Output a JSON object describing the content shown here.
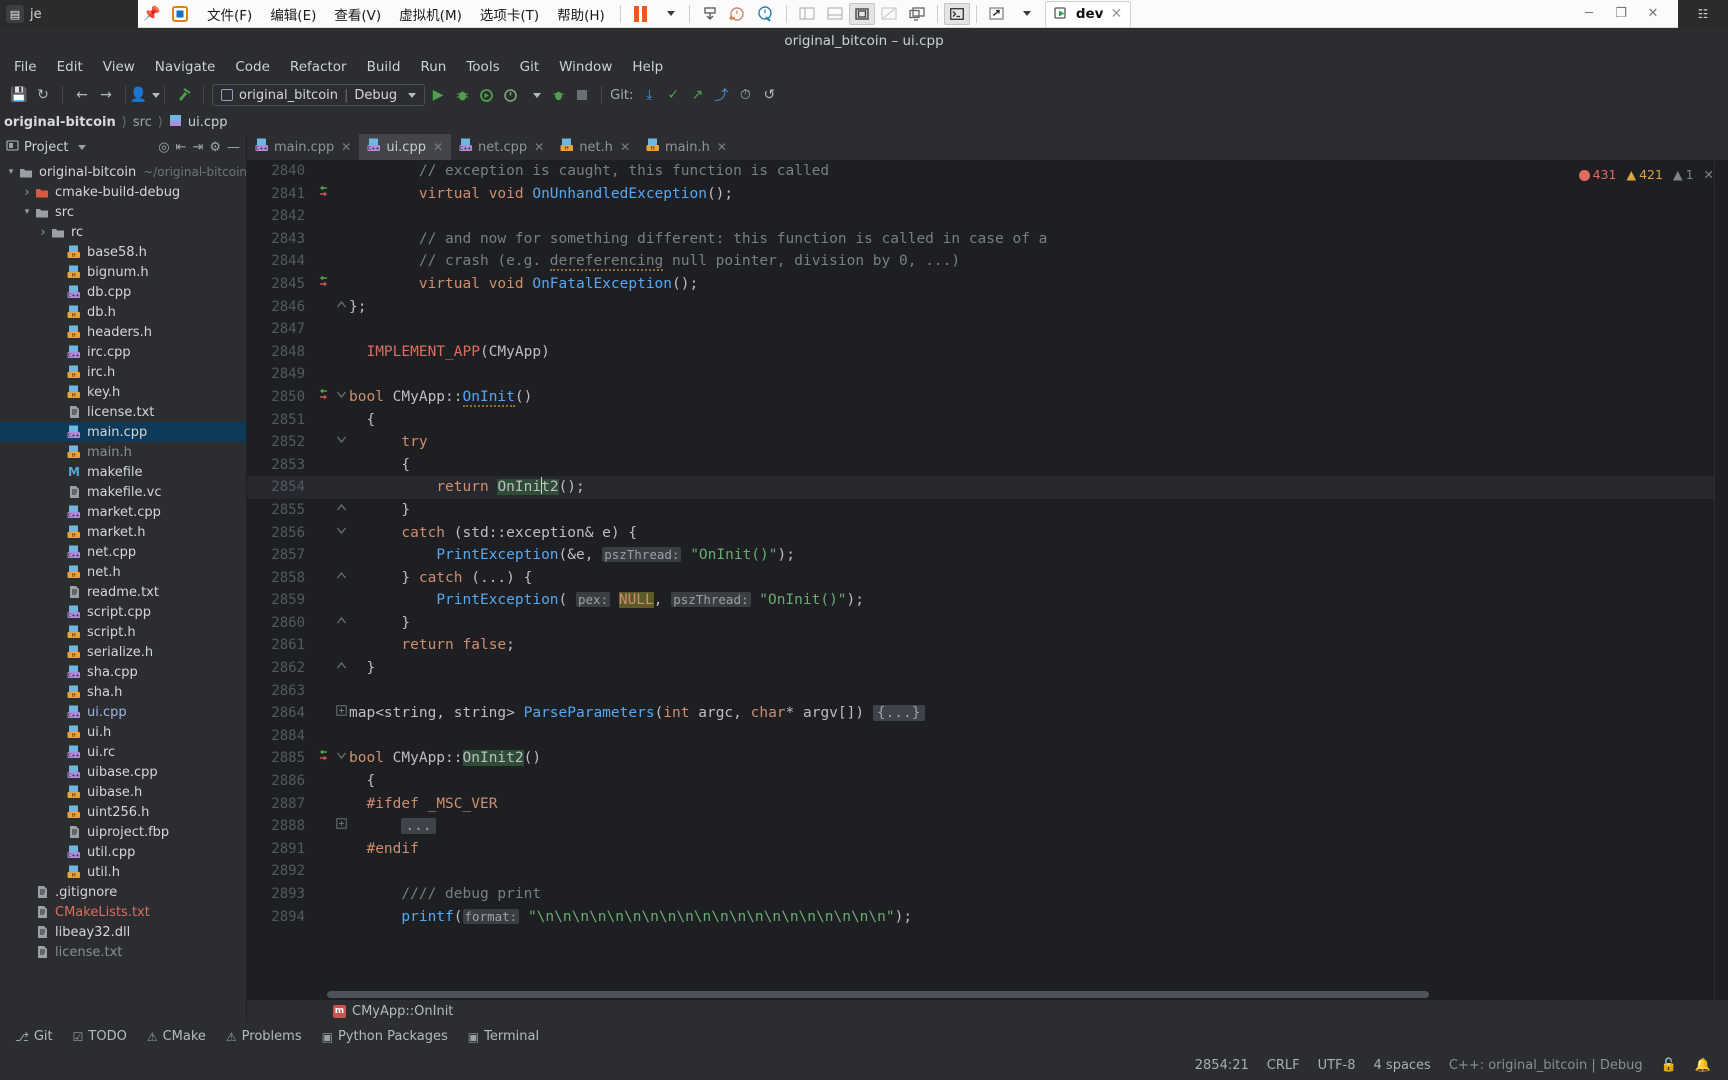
{
  "vmware": {
    "app_label": "je",
    "pin_icon": "pin-icon",
    "app_icon": "vmware-icon",
    "menus": [
      "文件(F)",
      "编辑(E)",
      "查看(V)",
      "虚拟机(M)",
      "选项卡(T)",
      "帮助(H)"
    ],
    "toolbar_icons": [
      "pause-icon",
      "dropdown-caret-icon",
      "send-ctrl-alt-del-icon",
      "snapshot-take-icon",
      "snapshot-revert-icon",
      "snapshot-manager-icon",
      "sidebar-toggle-icon",
      "console-view-icon",
      "fullscreen-icon",
      "unity-mode-icon",
      "multiple-monitors-icon",
      "terminal-icon",
      "expand-icon",
      "expand-caret-icon"
    ],
    "tab": {
      "label": "dev",
      "icon": "vm-power-icon",
      "close_icon": "close-icon"
    },
    "window_buttons": [
      "minimize-icon",
      "restore-icon",
      "close-icon"
    ],
    "right_strip_icon": "network-icon"
  },
  "ide": {
    "title": "original_bitcoin – ui.cpp",
    "menu": [
      "File",
      "Edit",
      "View",
      "Navigate",
      "Code",
      "Refactor",
      "Build",
      "Run",
      "Tools",
      "Git",
      "Window",
      "Help"
    ],
    "toolbar": {
      "save_icon": "save-icon",
      "sync_icon": "refresh-icon",
      "back_icon": "arrow-left-icon",
      "forward_icon": "arrow-right-icon",
      "user_icon": "user-icon",
      "build_icon": "hammer-icon",
      "run_config": {
        "name": "original_bitcoin",
        "mode": "Debug",
        "caret": "chevron-down-icon"
      },
      "run_icon": "run-icon",
      "debug_icon": "debug-icon",
      "coverage_icon": "run-coverage-icon",
      "profile_icon": "profiler-icon",
      "profile_caret": "chevron-down-icon",
      "attach_icon": "attach-process-icon",
      "stop_icon": "stop-icon",
      "git_label": "Git:",
      "git_update_icon": "git-update-icon",
      "git_commit_icon": "git-commit-icon",
      "git_push_icon": "git-push-icon",
      "git_branch_icon": "git-branch-icon",
      "git_history_icon": "history-icon",
      "git_rollback_icon": "rollback-icon"
    },
    "breadcrumb": {
      "root": "original-bitcoin",
      "parts": [
        "src"
      ],
      "file": "ui.cpp",
      "file_icon": "cpp-file-icon"
    }
  },
  "project": {
    "header": {
      "label": "Project",
      "caret": "chevron-down-icon"
    },
    "actions": [
      "locate-icon",
      "collapse-all-icon",
      "expand-all-icon",
      "settings-gear-icon",
      "hide-icon"
    ],
    "tree": [
      {
        "indent": 0,
        "arrow": "▾",
        "icon": "folder",
        "label": "original-bitcoin",
        "hint": "~/original-bitcoin",
        "style": ""
      },
      {
        "indent": 1,
        "arrow": "›",
        "icon": "folder-red",
        "label": "cmake-build-debug",
        "hint": "",
        "style": ""
      },
      {
        "indent": 1,
        "arrow": "▾",
        "icon": "folder",
        "label": "src",
        "hint": "",
        "style": ""
      },
      {
        "indent": 2,
        "arrow": "›",
        "icon": "folder",
        "label": "rc",
        "hint": "",
        "style": ""
      },
      {
        "indent": 3,
        "arrow": "",
        "icon": "h",
        "label": "base58.h",
        "hint": "",
        "style": ""
      },
      {
        "indent": 3,
        "arrow": "",
        "icon": "h",
        "label": "bignum.h",
        "hint": "",
        "style": ""
      },
      {
        "indent": 3,
        "arrow": "",
        "icon": "cpp",
        "label": "db.cpp",
        "hint": "",
        "style": ""
      },
      {
        "indent": 3,
        "arrow": "",
        "icon": "h",
        "label": "db.h",
        "hint": "",
        "style": ""
      },
      {
        "indent": 3,
        "arrow": "",
        "icon": "h",
        "label": "headers.h",
        "hint": "",
        "style": ""
      },
      {
        "indent": 3,
        "arrow": "",
        "icon": "cpp",
        "label": "irc.cpp",
        "hint": "",
        "style": ""
      },
      {
        "indent": 3,
        "arrow": "",
        "icon": "h",
        "label": "irc.h",
        "hint": "",
        "style": ""
      },
      {
        "indent": 3,
        "arrow": "",
        "icon": "h",
        "label": "key.h",
        "hint": "",
        "style": ""
      },
      {
        "indent": 3,
        "arrow": "",
        "icon": "txt",
        "label": "license.txt",
        "hint": "",
        "style": ""
      },
      {
        "indent": 3,
        "arrow": "",
        "icon": "cpp",
        "label": "main.cpp",
        "hint": "",
        "style": "selected"
      },
      {
        "indent": 3,
        "arrow": "",
        "icon": "h",
        "label": "main.h",
        "hint": "",
        "style": "dim"
      },
      {
        "indent": 3,
        "arrow": "",
        "icon": "mk",
        "label": "makefile",
        "hint": "",
        "style": ""
      },
      {
        "indent": 3,
        "arrow": "",
        "icon": "txt",
        "label": "makefile.vc",
        "hint": "",
        "style": ""
      },
      {
        "indent": 3,
        "arrow": "",
        "icon": "cpp",
        "label": "market.cpp",
        "hint": "",
        "style": ""
      },
      {
        "indent": 3,
        "arrow": "",
        "icon": "h",
        "label": "market.h",
        "hint": "",
        "style": ""
      },
      {
        "indent": 3,
        "arrow": "",
        "icon": "cpp",
        "label": "net.cpp",
        "hint": "",
        "style": ""
      },
      {
        "indent": 3,
        "arrow": "",
        "icon": "h",
        "label": "net.h",
        "hint": "",
        "style": ""
      },
      {
        "indent": 3,
        "arrow": "",
        "icon": "txt",
        "label": "readme.txt",
        "hint": "",
        "style": ""
      },
      {
        "indent": 3,
        "arrow": "",
        "icon": "cpp",
        "label": "script.cpp",
        "hint": "",
        "style": ""
      },
      {
        "indent": 3,
        "arrow": "",
        "icon": "h",
        "label": "script.h",
        "hint": "",
        "style": ""
      },
      {
        "indent": 3,
        "arrow": "",
        "icon": "h",
        "label": "serialize.h",
        "hint": "",
        "style": ""
      },
      {
        "indent": 3,
        "arrow": "",
        "icon": "cpp",
        "label": "sha.cpp",
        "hint": "",
        "style": ""
      },
      {
        "indent": 3,
        "arrow": "",
        "icon": "h",
        "label": "sha.h",
        "hint": "",
        "style": ""
      },
      {
        "indent": 3,
        "arrow": "",
        "icon": "cpp",
        "label": "ui.cpp",
        "hint": "",
        "style": "blue"
      },
      {
        "indent": 3,
        "arrow": "",
        "icon": "h",
        "label": "ui.h",
        "hint": "",
        "style": ""
      },
      {
        "indent": 3,
        "arrow": "",
        "icon": "cpp",
        "label": "ui.rc",
        "hint": "",
        "style": ""
      },
      {
        "indent": 3,
        "arrow": "",
        "icon": "cpp",
        "label": "uibase.cpp",
        "hint": "",
        "style": ""
      },
      {
        "indent": 3,
        "arrow": "",
        "icon": "h",
        "label": "uibase.h",
        "hint": "",
        "style": ""
      },
      {
        "indent": 3,
        "arrow": "",
        "icon": "h",
        "label": "uint256.h",
        "hint": "",
        "style": ""
      },
      {
        "indent": 3,
        "arrow": "",
        "icon": "txt",
        "label": "uiproject.fbp",
        "hint": "",
        "style": ""
      },
      {
        "indent": 3,
        "arrow": "",
        "icon": "cpp",
        "label": "util.cpp",
        "hint": "",
        "style": ""
      },
      {
        "indent": 3,
        "arrow": "",
        "icon": "h",
        "label": "util.h",
        "hint": "",
        "style": ""
      },
      {
        "indent": 1,
        "arrow": "",
        "icon": "txt",
        "label": ".gitignore",
        "hint": "",
        "style": ""
      },
      {
        "indent": 1,
        "arrow": "",
        "icon": "txt",
        "label": "CMakeLists.txt",
        "hint": "",
        "style": "red"
      },
      {
        "indent": 1,
        "arrow": "",
        "icon": "txt",
        "label": "libeay32.dll",
        "hint": "",
        "style": ""
      },
      {
        "indent": 1,
        "arrow": "",
        "icon": "txt",
        "label": "license.txt",
        "hint": "",
        "style": "dim"
      }
    ]
  },
  "editor_tabs": [
    {
      "label": "main.cpp",
      "icon": "cpp-file-icon",
      "active": false
    },
    {
      "label": "ui.cpp",
      "icon": "cpp-file-icon",
      "active": true
    },
    {
      "label": "net.cpp",
      "icon": "cpp-file-icon",
      "active": false
    },
    {
      "label": "net.h",
      "icon": "h-file-icon",
      "active": false
    },
    {
      "label": "main.h",
      "icon": "h-file-icon",
      "active": false
    }
  ],
  "inspections": {
    "errors": "431",
    "warnings": "421",
    "weak": "1",
    "error_icon": "error-circle-icon",
    "warning_icon": "warning-triangle-icon",
    "weak_icon": "weak-warning-icon",
    "close_icon": "close-icon"
  },
  "code": {
    "file": "ui.cpp",
    "lines": [
      {
        "n": "2840",
        "mark": "",
        "fold": "",
        "html": "        <span class=\"cmt\">// exception is caught, this function is called</span>"
      },
      {
        "n": "2841",
        "mark": "override",
        "fold": "",
        "html": "        <span class=\"kw\">virtual</span> <span class=\"kw\">void</span> <span class=\"fn\">OnUnhandledException</span>();"
      },
      {
        "n": "2842",
        "mark": "",
        "fold": "",
        "html": ""
      },
      {
        "n": "2843",
        "mark": "",
        "fold": "",
        "html": "        <span class=\"cmt\">// and now for something different: this function is called in case of a</span>"
      },
      {
        "n": "2844",
        "mark": "",
        "fold": "",
        "html": "        <span class=\"cmt\">// crash (e.g. <span class=\"squiggle\">dereferencing</span> null pointer, division by 0, ...)</span>"
      },
      {
        "n": "2845",
        "mark": "override",
        "fold": "",
        "html": "        <span class=\"kw\">virtual</span> <span class=\"kw\">void</span> <span class=\"fn\">OnFatalException</span>();"
      },
      {
        "n": "2846",
        "mark": "",
        "fold": "end",
        "html": "};"
      },
      {
        "n": "2847",
        "mark": "",
        "fold": "",
        "html": ""
      },
      {
        "n": "2848",
        "mark": "",
        "fold": "",
        "html": "  <span class=\"mac\">IMPLEMENT_APP</span>(CMyApp)"
      },
      {
        "n": "2849",
        "mark": "",
        "fold": "",
        "html": ""
      },
      {
        "n": "2850",
        "mark": "override",
        "fold": "start",
        "html": "<span class=\"kw\">bool</span> <span class=\"ty\">CMyApp</span>::<span class=\"fn squiggle\">OnInit</span>()"
      },
      {
        "n": "2851",
        "mark": "",
        "fold": "",
        "html": "  {"
      },
      {
        "n": "2852",
        "mark": "",
        "fold": "start",
        "html": "      <span class=\"kw\">try</span>"
      },
      {
        "n": "2853",
        "mark": "",
        "fold": "",
        "html": "      {"
      },
      {
        "n": "2854",
        "mark": "",
        "fold": "",
        "cur": true,
        "html": "          <span class=\"kw\">return</span> <span class=\"hl-green\">OnIni<span class=\"caret\"></span>t2</span>();"
      },
      {
        "n": "2855",
        "mark": "",
        "fold": "end",
        "html": "      }"
      },
      {
        "n": "2856",
        "mark": "",
        "fold": "start",
        "html": "      <span class=\"kw\">catch</span> (std::exception&amp; e) {"
      },
      {
        "n": "2857",
        "mark": "",
        "fold": "",
        "html": "          <span class=\"fn\">PrintException</span>(&amp;e, <span class=\"hint-param\">pszThread:</span> <span class=\"str\">\"OnInit()\"</span>);"
      },
      {
        "n": "2858",
        "mark": "",
        "fold": "end",
        "html": "      } <span class=\"kw\">catch</span> (...) {"
      },
      {
        "n": "2859",
        "mark": "",
        "fold": "",
        "html": "          <span class=\"fn\">PrintException</span>( <span class=\"hint-param\">pex:</span> <span class=\"hl-olive\">NULL</span>, <span class=\"hint-param\">pszThread:</span> <span class=\"str\">\"OnInit()\"</span>);"
      },
      {
        "n": "2860",
        "mark": "",
        "fold": "end",
        "html": "      }"
      },
      {
        "n": "2861",
        "mark": "",
        "fold": "",
        "html": "      <span class=\"kw\">return</span> <span class=\"kw\">false</span>;"
      },
      {
        "n": "2862",
        "mark": "",
        "fold": "end",
        "html": "  }"
      },
      {
        "n": "2863",
        "mark": "",
        "fold": "",
        "html": ""
      },
      {
        "n": "2864",
        "mark": "",
        "fold": "plus",
        "html": "map&lt;string, string&gt; <span class=\"fn\">ParseParameters</span>(<span class=\"kw\">int</span> argc, <span class=\"kw\">char</span>* argv[]) <span class=\"hl-fold\">{...}</span>"
      },
      {
        "n": "2884",
        "mark": "",
        "fold": "",
        "html": ""
      },
      {
        "n": "2885",
        "mark": "override",
        "fold": "start",
        "html": "<span class=\"kw\">bool</span> <span class=\"ty\">CMyApp</span>::<span class=\"hl-green\">OnInit2</span>()"
      },
      {
        "n": "2886",
        "mark": "",
        "fold": "",
        "html": "  {"
      },
      {
        "n": "2887",
        "mark": "",
        "fold": "",
        "html": "  <span class=\"ppk\">#ifdef</span> <span class=\"ppk\">_MSC_VER</span>"
      },
      {
        "n": "2888",
        "mark": "",
        "fold": "plus",
        "html": "      <span class=\"hl-fold\">...</span>"
      },
      {
        "n": "2891",
        "mark": "",
        "fold": "",
        "html": "  <span class=\"ppk\">#endif</span>"
      },
      {
        "n": "2892",
        "mark": "",
        "fold": "",
        "html": ""
      },
      {
        "n": "2893",
        "mark": "",
        "fold": "",
        "html": "      <span class=\"cmt\">//// debug print</span>"
      },
      {
        "n": "2894",
        "mark": "",
        "fold": "",
        "html": "      <span class=\"fn\">printf</span>(<span class=\"hint-param\">format:</span> <span class=\"str\">\"\\n\\n\\n\\n\\n\\n\\n\\n\\n\\n\\n\\n\\n\\n\\n\\n\\n\\n\\n\\n\"</span>);"
      }
    ]
  },
  "editor_status": {
    "icon": "method-icon",
    "path": "CMyApp::OnInit"
  },
  "toolwindows": [
    {
      "label": "Git",
      "icon": "git-icon"
    },
    {
      "label": "TODO",
      "icon": "todo-icon"
    },
    {
      "label": "CMake",
      "icon": "cmake-icon"
    },
    {
      "label": "Problems",
      "icon": "problems-icon"
    },
    {
      "label": "Python Packages",
      "icon": "python-icon"
    },
    {
      "label": "Terminal",
      "icon": "terminal-icon"
    }
  ],
  "statusbar": {
    "caret": "2854:21",
    "line_ending": "CRLF",
    "encoding": "UTF-8",
    "indent": "4 spaces",
    "config": "C++: original_bitcoin | Debug",
    "lock_icon": "lock-icon",
    "notify_icon": "bell-icon"
  },
  "colors": {
    "accent_blue": "#3574f0",
    "error_red": "#e06c5e",
    "warning_yellow": "#d9a441",
    "selection_blue": "#0d3a58",
    "editor_bg": "#1e1f22",
    "panel_bg": "#2b2d30"
  }
}
